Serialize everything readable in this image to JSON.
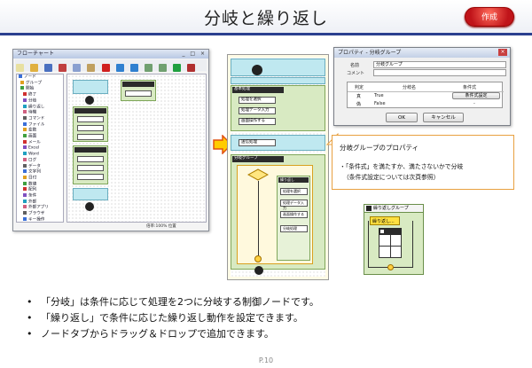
{
  "slide": {
    "title": "分岐と繰り返し",
    "create_button": "作成",
    "page": "P.10"
  },
  "flowchart_window": {
    "title": "フローチャート",
    "window_buttons": "_ □ ×",
    "tree_items": [
      "ノード",
      "グループ",
      "開始",
      "終了",
      "分岐",
      "繰り返し",
      "待機",
      "コマンド",
      "ファイル",
      "変数",
      "画面",
      "メール",
      "Excel",
      "Word",
      "ログ",
      "データ",
      "文字列",
      "日付",
      "数値",
      "配列",
      "条件",
      "外部",
      "外部アプリ",
      "ブラウザ",
      "キー操作",
      "マウス",
      "印刷",
      "その他",
      "通知",
      "停止"
    ],
    "tree_icon_colors": [
      "#3a6fd8",
      "#e0a020",
      "#40a040",
      "#d03030",
      "#8050c0",
      "#20a0c0",
      "#d06080",
      "#606060"
    ],
    "statusbar": "倍率:100%  位置"
  },
  "zoom_flow": {
    "nodes": [
      "基本処理",
      "処理を選択",
      "処理データ入力",
      "画面操作する",
      "送信処理",
      "分岐グループ",
      "繰り返し",
      "処理を選択",
      "処理データ入力",
      "画面操作する",
      "分岐処理"
    ]
  },
  "property_dialog": {
    "title": "プロパティ - 分岐グループ",
    "name_label": "名前",
    "name_value": "分岐グループ",
    "comment_label": "コメント",
    "table_headers": [
      "判定",
      "分岐名",
      "条件式"
    ],
    "rows": [
      {
        "judge": "真",
        "name": "True",
        "cond": "条件式設定"
      },
      {
        "judge": "偽",
        "name": "False",
        "cond": "-"
      }
    ],
    "ok": "OK",
    "cancel": "キャンセル"
  },
  "callout": {
    "title": "分岐グループのプロパティ",
    "line1": "・「条件式」を満たすか、満たさないかで分岐",
    "line2": "（条件式設定については次頁参照）"
  },
  "loop_group": {
    "title": "繰り返しグループ",
    "label": "繰り返し..."
  },
  "bullets": [
    "「分岐」は条件に応じて処理を2つに分岐する制御ノードです。",
    "「繰り返し」で条件に応じた繰り返し動作を設定できます。",
    "ノードタブからドラッグ＆ドロップで追加できます。"
  ],
  "colors": {
    "accent_header_line": "#2a3f8f",
    "create_button": "#c0141a",
    "arrow": "#ffcc00",
    "callout_border": "#e8a040",
    "node_blue": "#bfe8f0",
    "node_green": "#d8eac2"
  }
}
